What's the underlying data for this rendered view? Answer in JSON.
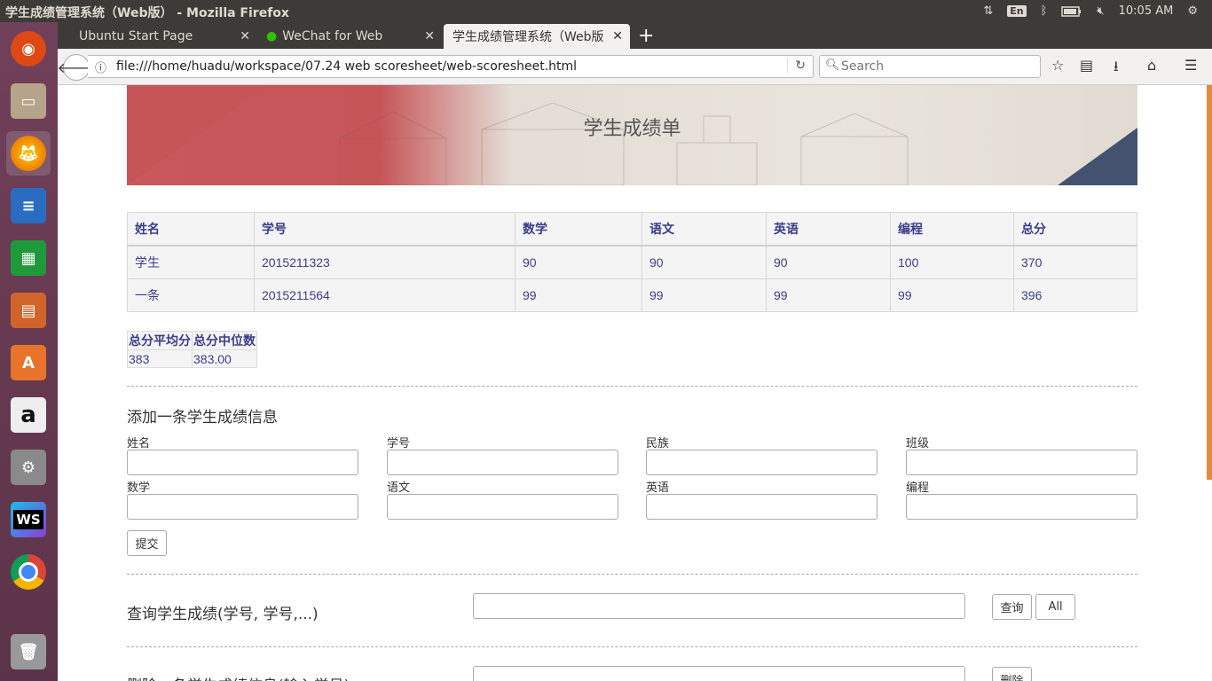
{
  "window": {
    "title": "学生成绩管理系统（Web版） - Mozilla Firefox"
  },
  "tray": {
    "keyboard": "En",
    "time": "10:05 AM"
  },
  "launcher": [
    "ubuntu-dash",
    "files",
    "firefox",
    "libreoffice-writer",
    "libreoffice-calc",
    "libreoffice-impress",
    "ubuntu-software",
    "amazon",
    "system-settings",
    "webstorm",
    "chrome",
    "trash"
  ],
  "tabs": [
    {
      "label": "Ubuntu Start Page"
    },
    {
      "label": "WeChat for Web"
    },
    {
      "label": "学生成绩管理系统（Web版"
    }
  ],
  "nav": {
    "url": "file:///home/huadu/workspace/07.24 web scoresheet/web-scoresheet.html",
    "search_placeholder": "Search"
  },
  "page": {
    "banner_title": "学生成绩单",
    "table": {
      "headers": [
        "姓名",
        "学号",
        "数学",
        "语文",
        "英语",
        "编程",
        "总分"
      ],
      "rows": [
        [
          "学生",
          "2015211323",
          "90",
          "90",
          "90",
          "100",
          "370"
        ],
        [
          "一条",
          "2015211564",
          "99",
          "99",
          "99",
          "99",
          "396"
        ]
      ]
    },
    "stats": {
      "headers": [
        "总分平均分",
        "总分中位数"
      ],
      "values": [
        "383",
        "383.00"
      ]
    },
    "add_form": {
      "title": "添加一条学生成绩信息",
      "fields": [
        "姓名",
        "学号",
        "民族",
        "班级",
        "数学",
        "语文",
        "英语",
        "编程"
      ],
      "submit": "提交"
    },
    "query": {
      "title": "查询学生成绩(学号, 学号,...)",
      "query_btn": "查询",
      "all_btn": "All"
    },
    "delete": {
      "title": "删除一条学生成绩信息(输入学号)",
      "delete_btn": "删除"
    }
  }
}
